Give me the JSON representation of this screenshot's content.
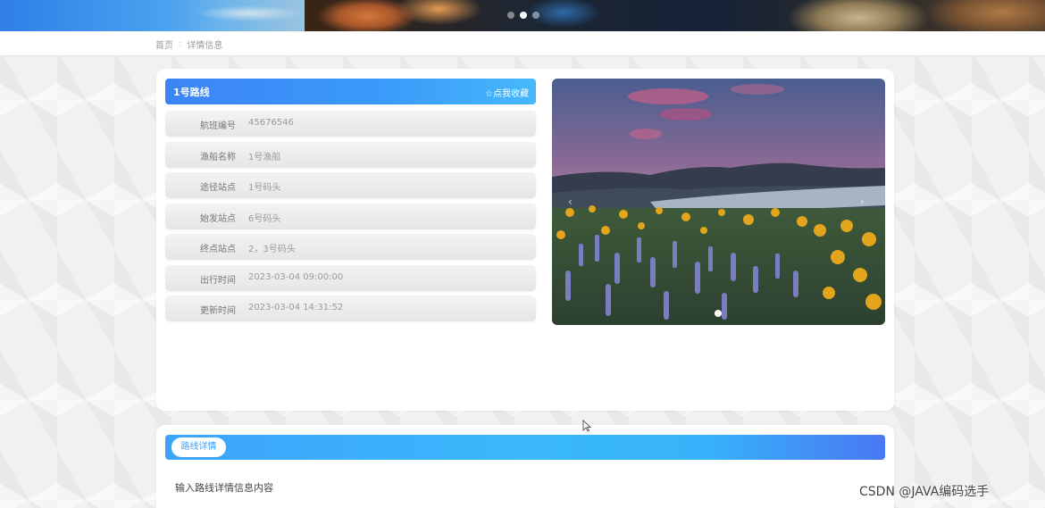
{
  "banner": {
    "carousel_count": 3,
    "active_index": 1
  },
  "breadcrumb": {
    "home": "首页",
    "separator": ":",
    "current": "详情信息"
  },
  "route": {
    "title": "1号路线",
    "favorite": "☆点我收藏",
    "fields": [
      {
        "label": "航班编号",
        "value": "45676546"
      },
      {
        "label": "渔船名称",
        "value": "1号渔船"
      },
      {
        "label": "途径站点",
        "value": "1号码头"
      },
      {
        "label": "始发站点",
        "value": "6号码头"
      },
      {
        "label": "终点站点",
        "value": "2，3号码头"
      },
      {
        "label": "出行时间",
        "value": "2023-03-04 09:00:00"
      },
      {
        "label": "更新时间",
        "value": "2023-03-04 14:31:52"
      }
    ]
  },
  "photo": {
    "prev_icon": "‹",
    "next_icon": "›",
    "slide_count": 1
  },
  "details": {
    "tab_label": "路线详情",
    "content": "输入路线详情信息内容"
  },
  "watermark": "CSDN @JAVA编码选手"
}
